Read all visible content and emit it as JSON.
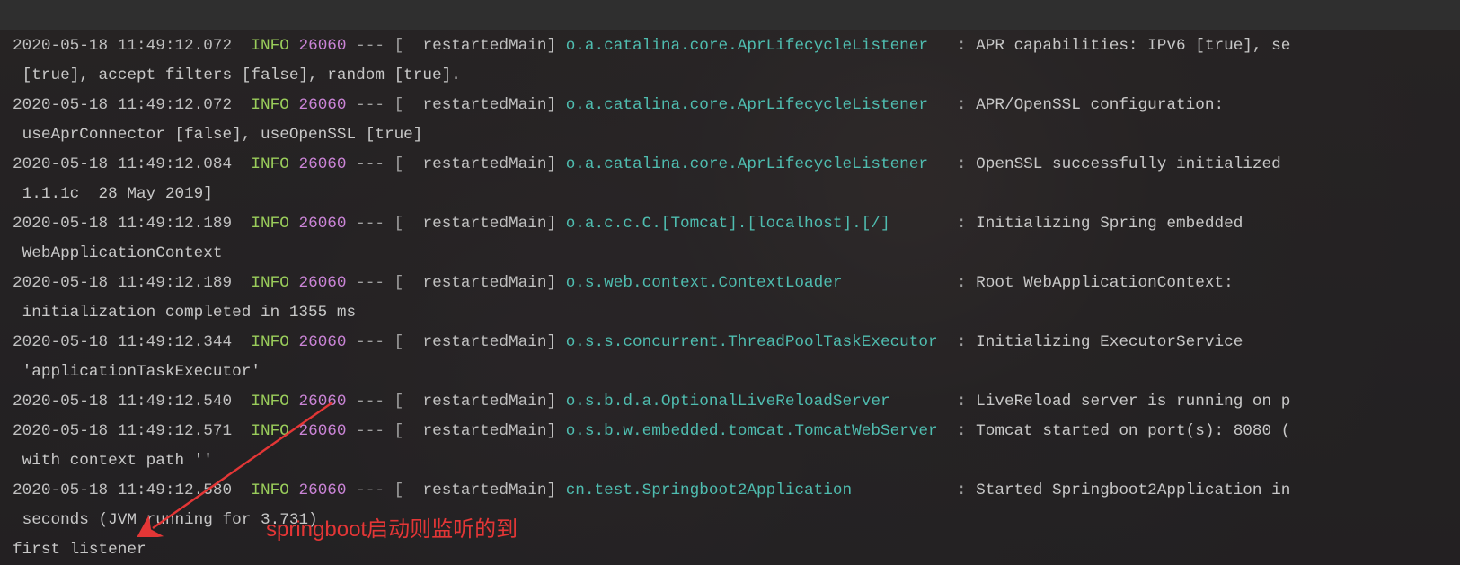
{
  "log_lines": [
    {
      "ts": "2020-05-18 11:49:12.072",
      "lvl": "INFO",
      "pid": "26060",
      "sep1": " --- [",
      "thr": "  restartedMain] ",
      "logger": "o.a.catalina.core.AprLifecycleListener   ",
      "col": ": ",
      "msg": "APR capabilities: IPv6 [true], se",
      "cont": " [true], accept filters [false], random [true]."
    },
    {
      "ts": "2020-05-18 11:49:12.072",
      "lvl": "INFO",
      "pid": "26060",
      "sep1": " --- [",
      "thr": "  restartedMain] ",
      "logger": "o.a.catalina.core.AprLifecycleListener   ",
      "col": ": ",
      "msg": "APR/OpenSSL configuration:",
      "cont": " useAprConnector [false], useOpenSSL [true]"
    },
    {
      "ts": "2020-05-18 11:49:12.084",
      "lvl": "INFO",
      "pid": "26060",
      "sep1": " --- [",
      "thr": "  restartedMain] ",
      "logger": "o.a.catalina.core.AprLifecycleListener   ",
      "col": ": ",
      "msg": "OpenSSL successfully initialized",
      "cont": " 1.1.1c  28 May 2019]"
    },
    {
      "ts": "2020-05-18 11:49:12.189",
      "lvl": "INFO",
      "pid": "26060",
      "sep1": " --- [",
      "thr": "  restartedMain] ",
      "logger": "o.a.c.c.C.[Tomcat].[localhost].[/]       ",
      "col": ": ",
      "msg": "Initializing Spring embedded",
      "cont": " WebApplicationContext"
    },
    {
      "ts": "2020-05-18 11:49:12.189",
      "lvl": "INFO",
      "pid": "26060",
      "sep1": " --- [",
      "thr": "  restartedMain] ",
      "logger": "o.s.web.context.ContextLoader            ",
      "col": ": ",
      "msg": "Root WebApplicationContext:",
      "cont": " initialization completed in 1355 ms"
    },
    {
      "ts": "2020-05-18 11:49:12.344",
      "lvl": "INFO",
      "pid": "26060",
      "sep1": " --- [",
      "thr": "  restartedMain] ",
      "logger": "o.s.s.concurrent.ThreadPoolTaskExecutor  ",
      "col": ": ",
      "msg": "Initializing ExecutorService",
      "cont": " 'applicationTaskExecutor'"
    },
    {
      "ts": "2020-05-18 11:49:12.540",
      "lvl": "INFO",
      "pid": "26060",
      "sep1": " --- [",
      "thr": "  restartedMain] ",
      "logger": "o.s.b.d.a.OptionalLiveReloadServer       ",
      "col": ": ",
      "msg": "LiveReload server is running on p",
      "cont": null
    },
    {
      "ts": "2020-05-18 11:49:12.571",
      "lvl": "INFO",
      "pid": "26060",
      "sep1": " --- [",
      "thr": "  restartedMain] ",
      "logger": "o.s.b.w.embedded.tomcat.TomcatWebServer  ",
      "col": ": ",
      "msg": "Tomcat started on port(s): 8080 (",
      "cont": " with context path ''"
    },
    {
      "ts": "2020-05-18 11:49:12.580",
      "lvl": "INFO",
      "pid": "26060",
      "sep1": " --- [",
      "thr": "  restartedMain] ",
      "logger": "cn.test.Springboot2Application           ",
      "col": ": ",
      "msg": "Started Springboot2Application in",
      "cont": " seconds (JVM running for 3.731)"
    }
  ],
  "stdout_line": "first listener",
  "annotation": {
    "text": "springboot启动则监听的到",
    "color": "#e33636"
  }
}
